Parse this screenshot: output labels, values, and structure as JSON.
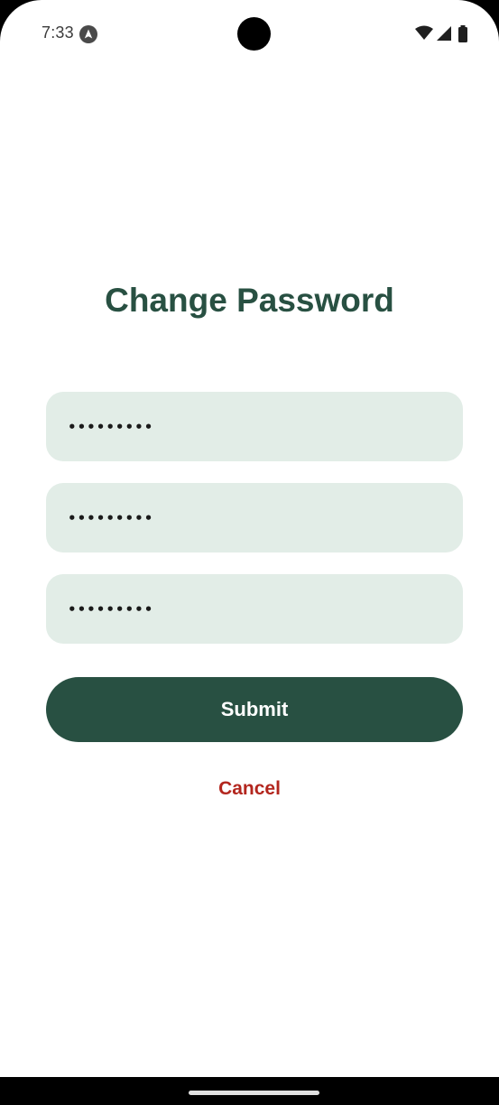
{
  "status_bar": {
    "time": "7:33",
    "app_icon": "navigation-arrow-icon",
    "icons": [
      "wifi-icon",
      "cellular-signal-icon",
      "battery-icon"
    ]
  },
  "screen": {
    "title": "Change Password"
  },
  "form": {
    "fields": [
      {
        "name": "current-password",
        "value": "•••••••••"
      },
      {
        "name": "new-password",
        "value": "•••••••••"
      },
      {
        "name": "confirm-password",
        "value": "•••••••••"
      }
    ],
    "submit_label": "Submit",
    "cancel_label": "Cancel"
  },
  "colors": {
    "primary": "#285042",
    "field_background": "#e2ede7",
    "cancel": "#b3261e"
  }
}
